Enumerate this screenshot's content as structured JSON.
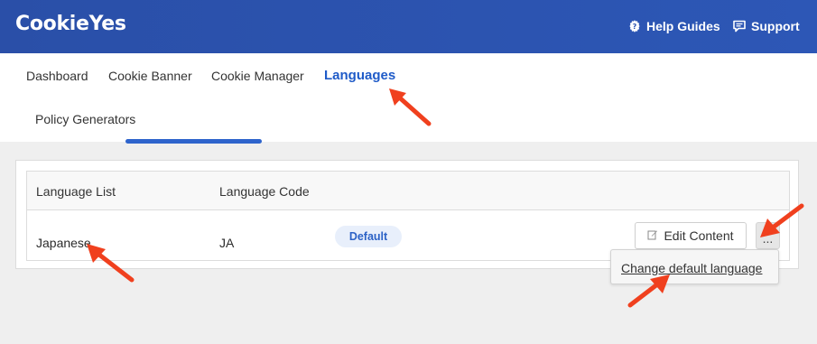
{
  "header": {
    "logo_text": "CookieYes",
    "help_label": "Help Guides",
    "support_label": "Support",
    "bg_color": "#2b52b0"
  },
  "nav": {
    "items": [
      {
        "label": "Dashboard"
      },
      {
        "label": "Cookie Banner"
      },
      {
        "label": "Cookie Manager"
      },
      {
        "label": "Languages"
      },
      {
        "label": "Policy Generators"
      }
    ],
    "active": "Languages",
    "accent_color": "#1f5bc8"
  },
  "languages_table": {
    "headers": [
      "Language List",
      "Language Code"
    ],
    "rows": [
      {
        "language": "Japanese",
        "code": "JA",
        "badge": "Default",
        "edit_label": "Edit Content",
        "more_label": "..."
      }
    ]
  },
  "dropdown": {
    "items": [
      "Change default language"
    ]
  },
  "annotation_color": "#f0401e"
}
